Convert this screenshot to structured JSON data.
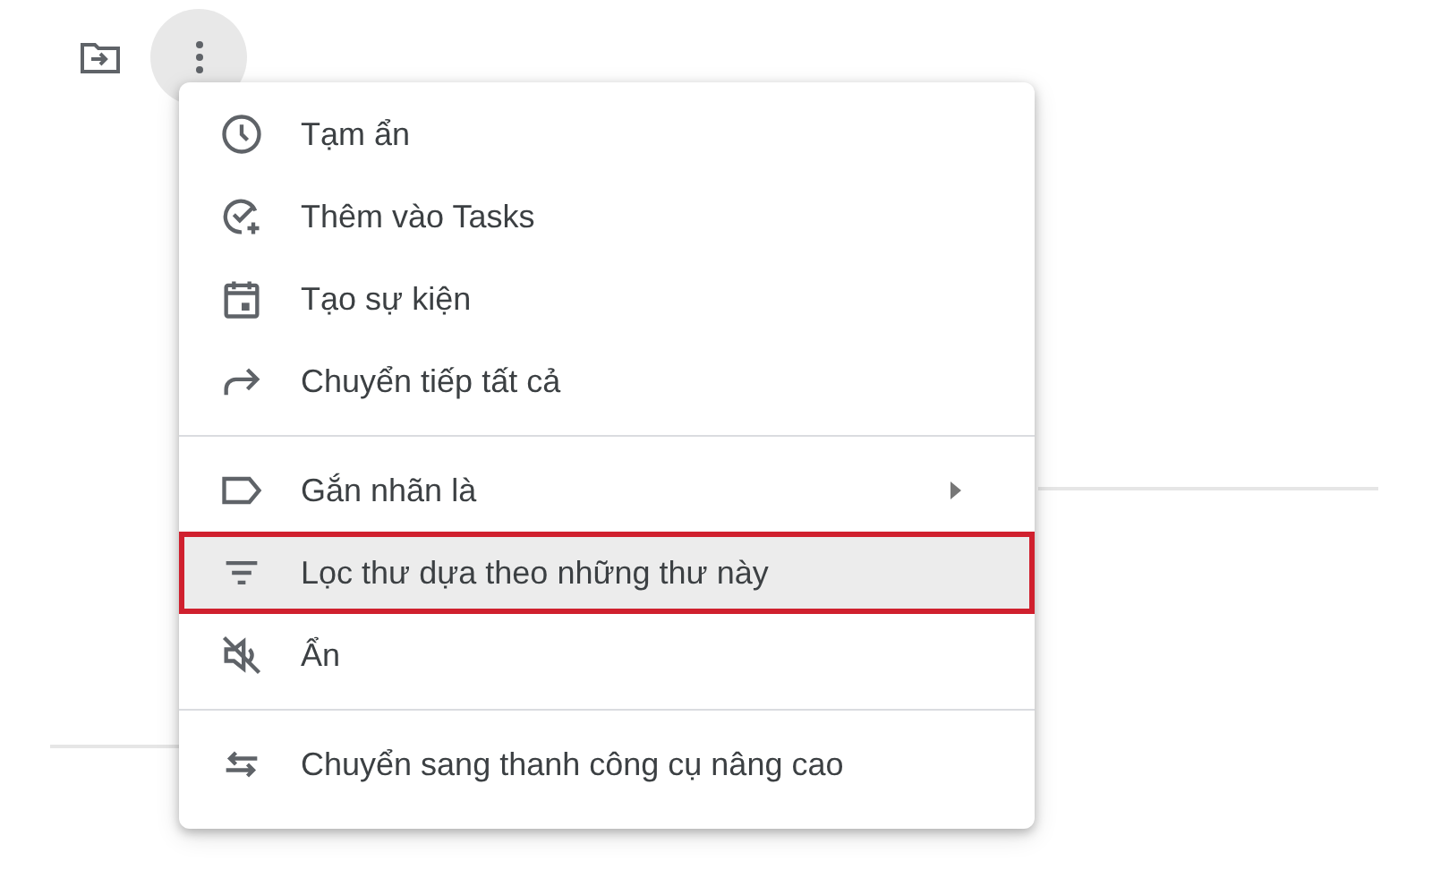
{
  "toolbar": {
    "buttons": [
      {
        "pressed": false
      },
      {
        "pressed": true
      }
    ]
  },
  "menu": {
    "groups": [
      {
        "items": [
          {
            "label": "Tạm ẩn",
            "submenu": false,
            "highlighted": false
          },
          {
            "label": "Thêm vào Tasks",
            "submenu": false,
            "highlighted": false
          },
          {
            "label": "Tạo sự kiện",
            "submenu": false,
            "highlighted": false
          },
          {
            "label": "Chuyển tiếp tất cả",
            "submenu": false,
            "highlighted": false
          }
        ]
      },
      {
        "items": [
          {
            "label": "Gắn nhãn là",
            "submenu": true,
            "highlighted": false
          },
          {
            "label": "Lọc thư dựa theo những thư này",
            "submenu": false,
            "highlighted": true
          },
          {
            "label": "Ẩn",
            "submenu": false,
            "highlighted": false
          }
        ]
      },
      {
        "items": [
          {
            "label": "Chuyển sang thanh công cụ nâng cao",
            "submenu": false,
            "highlighted": false
          }
        ]
      }
    ]
  }
}
